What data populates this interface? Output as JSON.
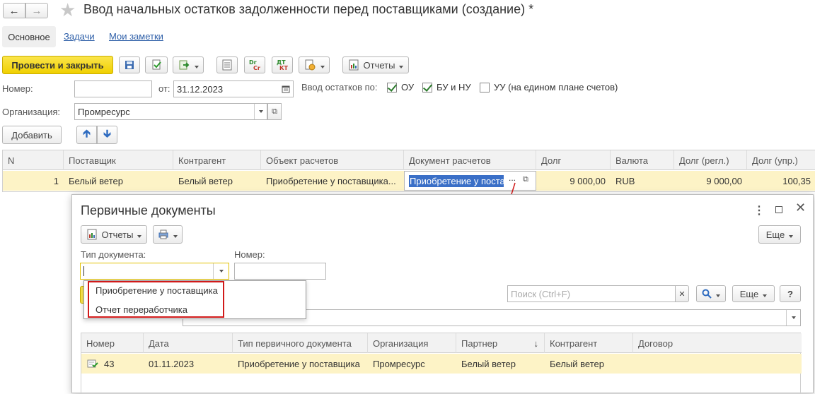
{
  "window": {
    "title": "Ввод начальных остатков задолженности перед поставщиками (создание) *"
  },
  "nav_tabs": [
    {
      "label": "Основное"
    },
    {
      "label": "Задачи"
    },
    {
      "label": "Мои заметки"
    }
  ],
  "toolbar": {
    "post_close_label": "Провести и закрыть",
    "reports_label": "Отчеты"
  },
  "form": {
    "number_label": "Номер:",
    "number_value": "",
    "date_label": "от:",
    "date_value": "31.12.2023",
    "input_by_label": "Ввод остатков по:",
    "check_ou_label": "ОУ",
    "check_bu_label": "БУ и НУ",
    "check_uu_label": "УУ (на едином плане счетов)",
    "org_label": "Организация:",
    "org_value": "Промресурс",
    "add_label": "Добавить"
  },
  "main_table": {
    "columns": [
      "N",
      "Поставщик",
      "Контрагент",
      "Объект расчетов",
      "Документ расчетов",
      "Долг",
      "Валюта",
      "Долг (регл.)",
      "Долг (упр.)"
    ],
    "rows": [
      {
        "n": "1",
        "supplier": "Белый ветер",
        "counterparty": "Белый ветер",
        "object": "Приобретение у поставщика...",
        "document": "Приобретение у поста",
        "debt": "9 000,00",
        "currency": "RUB",
        "debt_regl": "9 000,00",
        "debt_upr": "100,35"
      }
    ]
  },
  "dialog": {
    "title": "Первичные документы",
    "reports_label": "Отчеты",
    "more_label": "Еще",
    "doc_type_label": "Тип документа:",
    "doc_type_value": "",
    "number_label": "Номер:",
    "number_value": "",
    "dropdown_options": [
      "Приобретение у поставщика",
      "Отчет переработчика"
    ],
    "search_placeholder": "Поиск (Ctrl+F)",
    "more2_label": "Еще",
    "help_label": "?",
    "table": {
      "columns": [
        "Номер",
        "Дата",
        "Тип первичного документа",
        "Организация",
        "Партнер",
        "Контрагент",
        "Договор"
      ],
      "sort_mark": "↓",
      "rows": [
        {
          "number": "43",
          "date": "01.11.2023",
          "type": "Приобретение у поставщика",
          "org": "Промресурс",
          "partner": "Белый ветер",
          "counterparty": "Белый ветер",
          "contract": ""
        }
      ]
    }
  },
  "colors": {
    "accent_yellow": "#f5d90f",
    "row_highlight": "#fdf3c6",
    "selection_blue": "#3a6fc7",
    "annotation_red": "#d11a1a"
  }
}
